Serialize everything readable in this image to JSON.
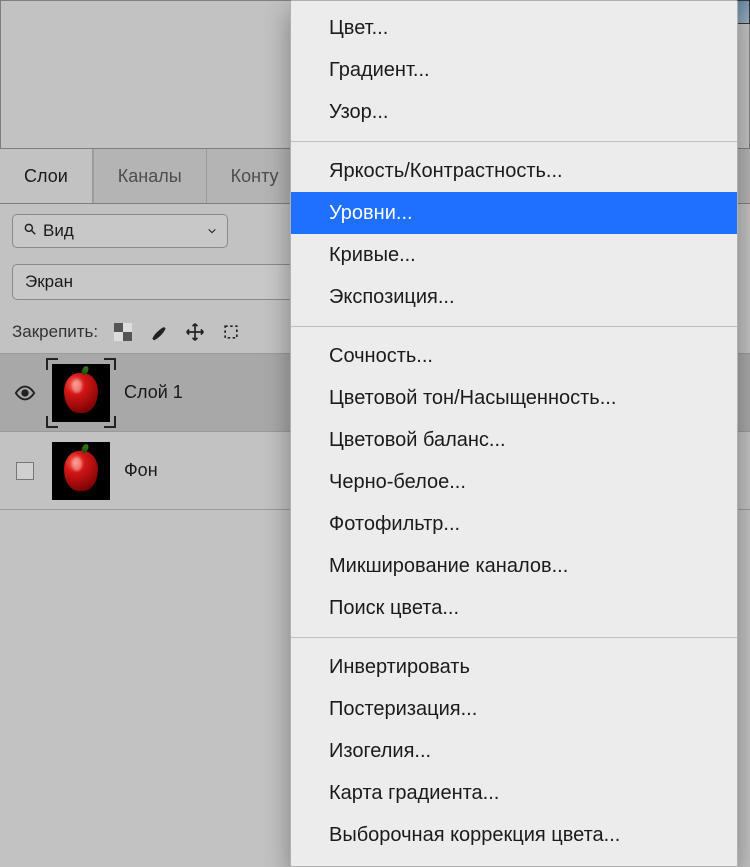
{
  "tabs": {
    "layers": "Слои",
    "channels": "Каналы",
    "paths_partial": "Конту"
  },
  "filter": {
    "view_label": "Вид"
  },
  "blend": {
    "mode": "Экран"
  },
  "lock": {
    "label": "Закрепить:"
  },
  "layers": {
    "layer1": {
      "name": "Слой 1"
    },
    "background": {
      "name": "Фон"
    }
  },
  "menu": {
    "group1": {
      "color": "Цвет...",
      "gradient": "Градиент...",
      "pattern": "Узор..."
    },
    "group2": {
      "brightness_contrast": "Яркость/Контрастность...",
      "levels": "Уровни...",
      "curves": "Кривые...",
      "exposure": "Экспозиция..."
    },
    "group3": {
      "vibrance": "Сочность...",
      "hue_sat": "Цветовой тон/Насыщенность...",
      "color_balance": "Цветовой баланс...",
      "black_white": "Черно-белое...",
      "photo_filter": "Фотофильтр...",
      "channel_mixer": "Микширование каналов...",
      "color_lookup": "Поиск цвета..."
    },
    "group4": {
      "invert": "Инвертировать",
      "posterize": "Постеризация...",
      "threshold": "Изогелия...",
      "gradient_map": "Карта градиента...",
      "selective_color": "Выборочная коррекция цвета..."
    }
  }
}
